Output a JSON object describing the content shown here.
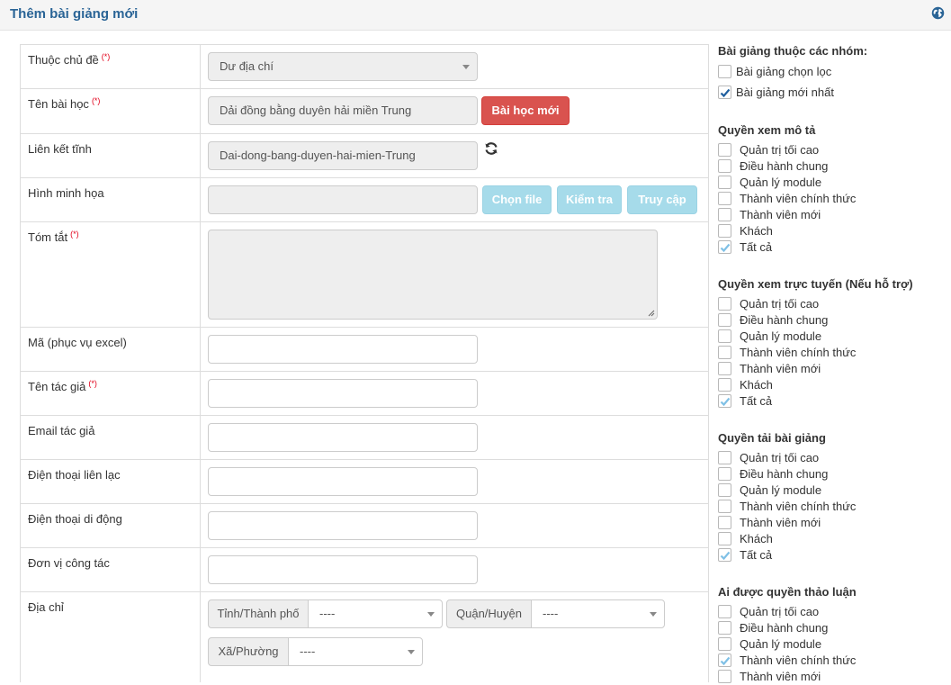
{
  "header": {
    "title": "Thêm bài giảng mới",
    "icon": "globe-icon"
  },
  "form": {
    "category": {
      "label": "Thuộc chủ đề",
      "required_mark": "(*)",
      "value": "Dư địa chí"
    },
    "title": {
      "label": "Tên bài học",
      "required_mark": "(*)",
      "value": "Dải đồng bằng duyên hải miền Trung",
      "new_button": "Bài học mới"
    },
    "alias": {
      "label": "Liên kết tĩnh",
      "value": "Dai-dong-bang-duyen-hai-mien-Trung",
      "refresh_icon": "refresh-icon"
    },
    "image": {
      "label": "Hình minh họa",
      "value": "",
      "choose_button": "Chọn file",
      "check_button": "Kiểm tra",
      "access_button": "Truy cập"
    },
    "summary": {
      "label": "Tóm tắt",
      "required_mark": "(*)",
      "value": ""
    },
    "code": {
      "label": "Mã (phục vụ excel)",
      "value": ""
    },
    "author": {
      "label": "Tên tác giả",
      "required_mark": "(*)",
      "value": ""
    },
    "author_email": {
      "label": "Email tác giả",
      "value": ""
    },
    "phone": {
      "label": "Điện thoại liên lạc",
      "value": ""
    },
    "mobile": {
      "label": "Điện thoại di động",
      "value": ""
    },
    "workplace": {
      "label": "Đơn vị công tác",
      "value": ""
    },
    "address": {
      "label": "Địa chỉ",
      "province_label": "Tỉnh/Thành phố",
      "province_value": "----",
      "district_label": "Quận/Huyện",
      "district_value": "----",
      "ward_label": "Xã/Phường",
      "ward_value": "----"
    }
  },
  "sidebar": {
    "groups": {
      "title": "Bài giảng thuộc các nhóm:",
      "items": [
        {
          "label": "Bài giảng chọn lọc",
          "checked": false
        },
        {
          "label": "Bài giảng mới nhất",
          "checked": true
        }
      ]
    },
    "view_desc": {
      "title": "Quyền xem mô tả",
      "items": [
        {
          "label": "Quản trị tối cao",
          "checked": false
        },
        {
          "label": "Điều hành chung",
          "checked": false
        },
        {
          "label": "Quản lý module",
          "checked": false
        },
        {
          "label": "Thành viên chính thức",
          "checked": false
        },
        {
          "label": "Thành viên mới",
          "checked": false
        },
        {
          "label": "Khách",
          "checked": false
        },
        {
          "label": "Tất cả",
          "checked": true
        }
      ]
    },
    "view_online": {
      "title": "Quyền xem trực tuyến (Nếu hỗ trợ)",
      "items": [
        {
          "label": "Quản trị tối cao",
          "checked": false
        },
        {
          "label": "Điều hành chung",
          "checked": false
        },
        {
          "label": "Quản lý module",
          "checked": false
        },
        {
          "label": "Thành viên chính thức",
          "checked": false
        },
        {
          "label": "Thành viên mới",
          "checked": false
        },
        {
          "label": "Khách",
          "checked": false
        },
        {
          "label": "Tất cả",
          "checked": true
        }
      ]
    },
    "download": {
      "title": "Quyền tải bài giảng",
      "items": [
        {
          "label": "Quản trị tối cao",
          "checked": false
        },
        {
          "label": "Điều hành chung",
          "checked": false
        },
        {
          "label": "Quản lý module",
          "checked": false
        },
        {
          "label": "Thành viên chính thức",
          "checked": false
        },
        {
          "label": "Thành viên mới",
          "checked": false
        },
        {
          "label": "Khách",
          "checked": false
        },
        {
          "label": "Tất cả",
          "checked": true
        }
      ]
    },
    "discuss": {
      "title": "Ai được quyền thảo luận",
      "items": [
        {
          "label": "Quản trị tối cao",
          "checked": false
        },
        {
          "label": "Điều hành chung",
          "checked": false
        },
        {
          "label": "Quản lý module",
          "checked": false
        },
        {
          "label": "Thành viên chính thức",
          "checked": true
        },
        {
          "label": "Thành viên mới",
          "checked": false
        }
      ]
    }
  },
  "colors": {
    "title": "#2a6496",
    "danger": "#d9534f",
    "info_disabled": "#a6dbea",
    "required": "#e2001a",
    "check_dark": "#1f5f9f",
    "check_light": "#7fc0e6"
  }
}
